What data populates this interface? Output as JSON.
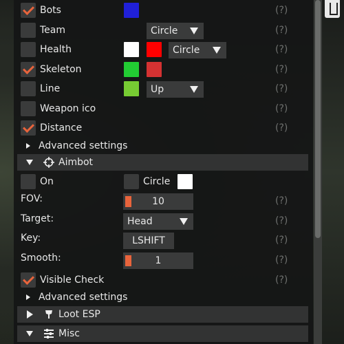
{
  "esp": {
    "bots": {
      "label": "Bots",
      "checked": true,
      "color": "#2020d8"
    },
    "team": {
      "label": "Team",
      "checked": false,
      "mode": "Circle"
    },
    "health": {
      "label": "Health",
      "checked": false,
      "color1": "#ffffff",
      "color2": "#ff0000",
      "mode": "Circle"
    },
    "skeleton": {
      "label": "Skeleton",
      "checked": true,
      "color1": "#22cc33",
      "color2": "#d43232"
    },
    "line": {
      "label": "Line",
      "checked": false,
      "color": "#77cc33",
      "mode": "Up"
    },
    "weapon": {
      "label": "Weapon ico",
      "checked": false
    },
    "distance": {
      "label": "Distance",
      "checked": true
    },
    "advanced": "Advanced settings"
  },
  "help": "(?)",
  "aimbot": {
    "header": "Aimbot",
    "on": {
      "label": "On",
      "checked": false
    },
    "circle": {
      "label": "Circle",
      "checked": false,
      "color": "#ffffff"
    },
    "fov": {
      "label": "FOV:",
      "value": "10"
    },
    "target": {
      "label": "Target:",
      "value": "Head"
    },
    "key": {
      "label": "Key:",
      "value": "LSHIFT"
    },
    "smooth": {
      "label": "Smooth:",
      "value": "1"
    },
    "visible_check": {
      "label": "Visible Check",
      "checked": true
    },
    "advanced": "Advanced settings"
  },
  "loot": {
    "header": "Loot ESP"
  },
  "misc": {
    "header": "Misc"
  }
}
